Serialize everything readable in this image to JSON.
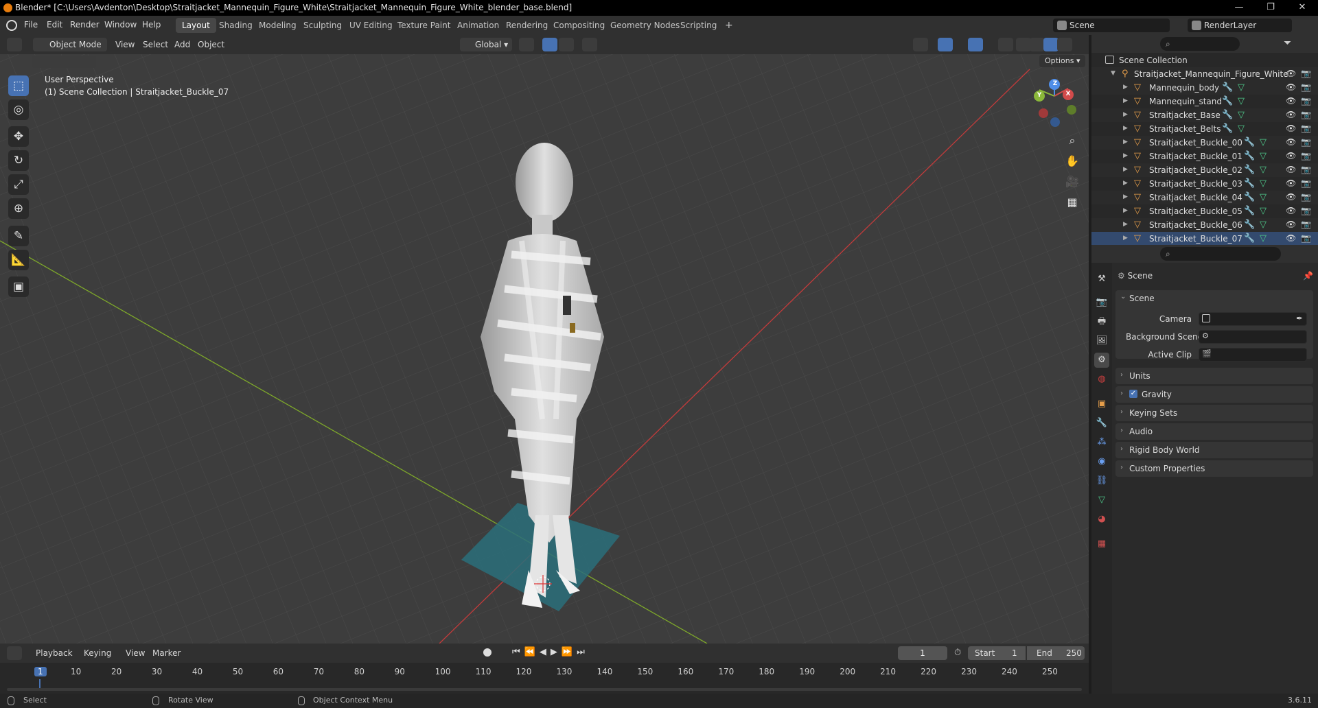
{
  "window": {
    "title": "Blender* [C:\\Users\\Avdenton\\Desktop\\Straitjacket_Mannequin_Figure_White\\Straitjacket_Mannequin_Figure_White_blender_base.blend]",
    "controls": [
      "—",
      "❐",
      "✕"
    ]
  },
  "menu": {
    "items": [
      "File",
      "Edit",
      "Render",
      "Window",
      "Help"
    ]
  },
  "workspaces": {
    "tabs": [
      "Layout",
      "Shading",
      "Modeling",
      "Sculpting",
      "UV Editing",
      "Texture Paint",
      "Animation",
      "Rendering",
      "Compositing",
      "Geometry Nodes",
      "Scripting"
    ],
    "active": "Layout",
    "add": "+"
  },
  "scene_selector": {
    "value": "Scene"
  },
  "view_layer": {
    "value": "RenderLayer"
  },
  "viewport": {
    "mode": "Object Mode",
    "menus": [
      "View",
      "Select",
      "Add",
      "Object"
    ],
    "orientation": "Global",
    "options_label": "Options",
    "overlay_title": "User Perspective",
    "overlay_subtitle": "(1) Scene Collection | Straitjacket_Buckle_07",
    "gizmo": {
      "x": "X",
      "y": "Y",
      "z": "Z"
    }
  },
  "outliner": {
    "root": "Scene Collection",
    "collection": "Straitjacket_Mannequin_Figure_White",
    "objects": [
      "Mannequin_body",
      "Mannequin_stand",
      "Straitjacket_Base",
      "Straitjacket_Belts",
      "Straitjacket_Buckle_00",
      "Straitjacket_Buckle_01",
      "Straitjacket_Buckle_02",
      "Straitjacket_Buckle_03",
      "Straitjacket_Buckle_04",
      "Straitjacket_Buckle_05",
      "Straitjacket_Buckle_06",
      "Straitjacket_Buckle_07"
    ]
  },
  "properties": {
    "context": "Scene",
    "panel_title": "Scene",
    "fields": {
      "camera": "Camera",
      "background_scene": "Background Scene",
      "active_clip": "Active Clip"
    },
    "panels": [
      "Units",
      "Gravity",
      "Keying Sets",
      "Audio",
      "Rigid Body World",
      "Custom Properties"
    ],
    "gravity_checked": true
  },
  "timeline": {
    "menus": [
      "Playback",
      "Keying",
      "View",
      "Marker"
    ],
    "current_frame": "1",
    "start_label": "Start",
    "start": "1",
    "end_label": "End",
    "end": "250",
    "ticks": [
      "1",
      "10",
      "20",
      "30",
      "40",
      "50",
      "60",
      "70",
      "80",
      "90",
      "100",
      "110",
      "120",
      "130",
      "140",
      "150",
      "160",
      "170",
      "180",
      "190",
      "200",
      "210",
      "220",
      "230",
      "240",
      "250"
    ]
  },
  "status": {
    "select": "Select",
    "rotate": "Rotate View",
    "context_menu": "Object Context Menu",
    "version": "3.6.11"
  },
  "colors": {
    "accent": "#4772b3",
    "mesh_icon": "#e69e4a",
    "x_axis": "#c43b3b",
    "y_axis": "#7ea82a"
  }
}
